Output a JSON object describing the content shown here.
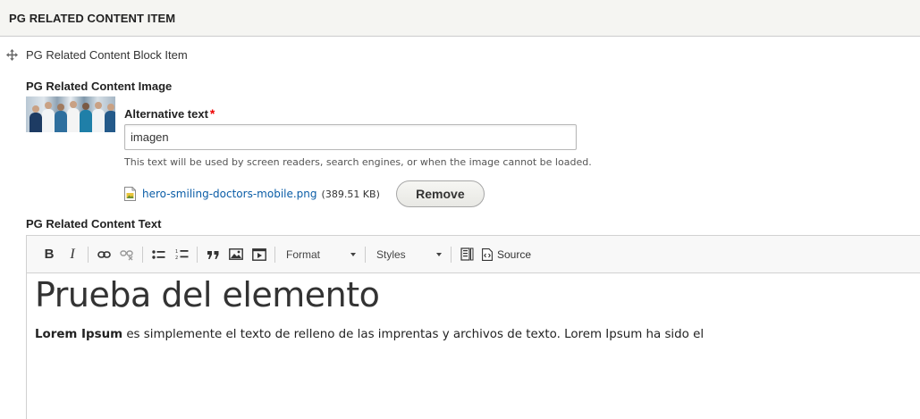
{
  "section": {
    "title": "PG RELATED CONTENT ITEM"
  },
  "block_item": {
    "label": "PG Related Content Block Item",
    "drag_icon": "move-icon"
  },
  "image_field": {
    "label": "PG Related Content Image",
    "alt_label": "Alternative text",
    "required_mark": "*",
    "alt_value": "imagen",
    "help_text": "This text will be used by screen readers, search engines, or when the image cannot be loaded.",
    "file_name": "hero-smiling-doctors-mobile.png",
    "file_size": "(389.51 KB)",
    "remove_label": "Remove"
  },
  "text_field": {
    "label": "PG Related Content Text",
    "toolbar": {
      "bold": "B",
      "italic": "I",
      "format_label": "Format",
      "styles_label": "Styles",
      "source_label": "Source"
    },
    "content": {
      "heading": "Prueba del elemento",
      "paragraph_bold": "Lorem Ipsum",
      "paragraph_rest": " es simplemente el texto de relleno de las imprentas y archivos de texto. Lorem Ipsum ha sido el"
    }
  },
  "colors": {
    "link": "#0b5da7",
    "required": "#e00000",
    "header_bg": "#f5f5f2"
  }
}
